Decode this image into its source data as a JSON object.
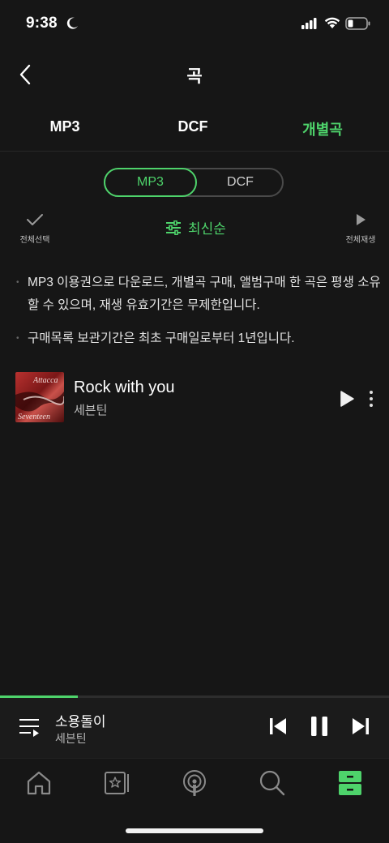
{
  "status": {
    "time": "9:38"
  },
  "header": {
    "title": "곡"
  },
  "tabs": [
    {
      "label": "MP3",
      "active": false
    },
    {
      "label": "DCF",
      "active": false
    },
    {
      "label": "개별곡",
      "active": true
    }
  ],
  "segment": {
    "options": [
      "MP3",
      "DCF"
    ],
    "selected": "MP3"
  },
  "actions": {
    "select_all": "전체선택",
    "sort": "최신순",
    "play_all": "전체재생"
  },
  "notices": [
    "MP3 이용권으로 다운로드, 개별곡 구매, 앨범구매 한 곡은 평생 소유할 수 있으며, 재생 유효기간은 무제한입니다.",
    "구매목록 보관기간은 최초 구매일로부터 1년입니다."
  ],
  "tracks": [
    {
      "title": "Rock with you",
      "artist": "세븐틴",
      "art_text": [
        "Attacca",
        "Seventeen"
      ]
    }
  ],
  "mini_player": {
    "title": "소용돌이",
    "artist": "세븐틴",
    "progress": 0.2
  },
  "nav": {
    "items": [
      "home-icon",
      "storage-box-icon",
      "podcast-icon",
      "search-icon",
      "library-icon"
    ],
    "active": "library-icon"
  },
  "colors": {
    "accent": "#4ed36b",
    "background": "#161616"
  }
}
